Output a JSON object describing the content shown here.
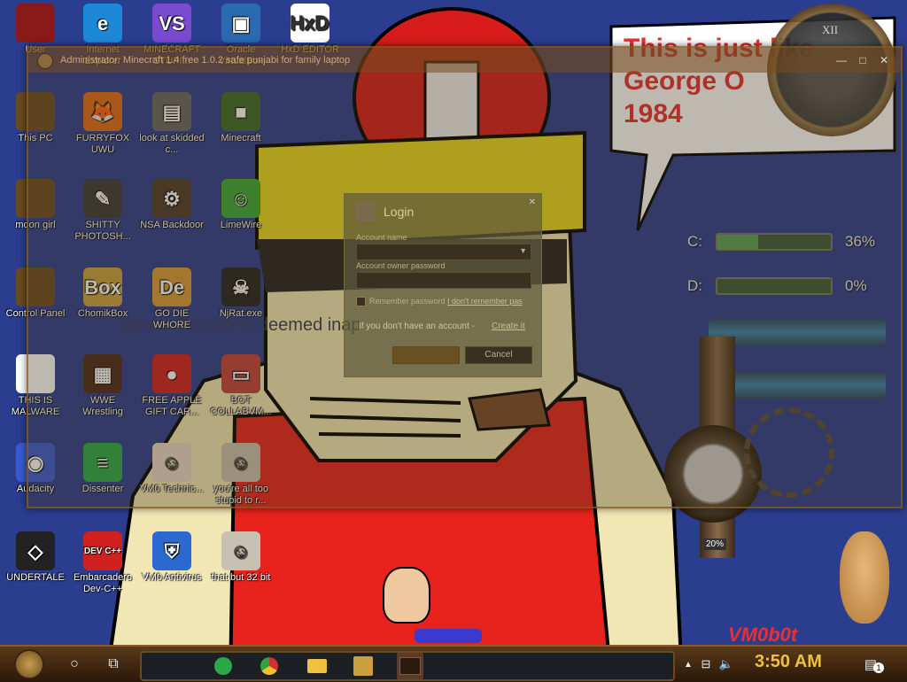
{
  "desktop_icons": [
    {
      "label": "User",
      "color": "#8a1a1a",
      "glyph": "",
      "icon": "user-folder-icon"
    },
    {
      "label": "Internet Explorer",
      "color": "#1e88d8",
      "glyph": "e",
      "icon": "edge-icon"
    },
    {
      "label": "MINECRAFT STUPI...",
      "color": "#7a4ad0",
      "glyph": "VS",
      "icon": "visual-studio-icon"
    },
    {
      "label": "Oracle VirtualBox",
      "color": "#2a6ab0",
      "glyph": "▣",
      "icon": "virtualbox-icon"
    },
    {
      "label": "HxD EDITOR",
      "color": "#ffffff",
      "glyph": "HxD",
      "icon": "hxd-icon"
    },
    {
      "label": "This PC",
      "color": "#6a4a20",
      "glyph": "",
      "icon": "this-pc-icon"
    },
    {
      "label": "FURRYFOX UWU",
      "color": "#e06a1a",
      "glyph": "🦊",
      "icon": "firefox-icon"
    },
    {
      "label": "look at skidded c...",
      "color": "#666666",
      "glyph": "▤",
      "icon": "files-icon"
    },
    {
      "label": "Minecraft",
      "color": "#3a6a2a",
      "glyph": "■",
      "icon": "minecraft-icon"
    },
    {
      "label": "moon girl",
      "color": "#6a4a20",
      "glyph": "",
      "icon": "moon-girl-icon"
    },
    {
      "label": "SHITTY PHOTOSH...",
      "color": "#3a3a3a",
      "glyph": "✎",
      "icon": "gimp-icon"
    },
    {
      "label": "NSA Backdoor",
      "color": "#4a3a2a",
      "glyph": "⚙",
      "icon": "nsa-backdoor-icon"
    },
    {
      "label": "LimeWire",
      "color": "#3aaa3a",
      "glyph": "☺",
      "icon": "limewire-icon"
    },
    {
      "label": "Control Panel",
      "color": "#6a4a20",
      "glyph": "",
      "icon": "control-panel-icon"
    },
    {
      "label": "ChomikBox",
      "color": "#c8a040",
      "glyph": "Box",
      "icon": "chomikbox-icon"
    },
    {
      "label": "GO DIE WHORE",
      "color": "#d89a3a",
      "glyph": "De",
      "icon": "dreamweaver-icon"
    },
    {
      "label": "NjRat.exe",
      "color": "#222222",
      "glyph": "☠",
      "icon": "skull-icon"
    },
    {
      "label": "THIS IS MALWARE",
      "color": "#ffffff",
      "glyph": "",
      "icon": "chrome-icon"
    },
    {
      "label": "WWE Wrestling",
      "color": "#4a2a1a",
      "glyph": "▦",
      "icon": "wwe-icon"
    },
    {
      "label": "FREE APPLE GIFT CAR...",
      "color": "#d02020",
      "glyph": "●",
      "icon": "apple-icon"
    },
    {
      "label": "BOT COLLABVM...",
      "color": "#c04040",
      "glyph": "▭",
      "icon": "bot-icon"
    },
    {
      "label": "Audacity",
      "color": "#3a5ad0",
      "glyph": "◉",
      "icon": "audacity-icon"
    },
    {
      "label": "Dissenter",
      "color": "#2aa84a",
      "glyph": "≡",
      "icon": "dissenter-icon"
    },
    {
      "label": "VM0 Technic...",
      "color": "#e8d8c8",
      "glyph": "☺",
      "icon": "technician-icon"
    },
    {
      "label": "you're all too stupid to r...",
      "color": "#c8c0b0",
      "glyph": "☺",
      "icon": "portrait-icon"
    },
    {
      "label": "UNDERTALE",
      "color": "#222222",
      "glyph": "◇",
      "icon": "unity-icon"
    },
    {
      "label": "Embarcadero Dev-C++",
      "color": "#d02020",
      "glyph": "DEV C++",
      "icon": "devcpp-icon"
    },
    {
      "label": "VM0 Antivirus",
      "color": "#2a6ad0",
      "glyph": "⛨",
      "icon": "shield-icon"
    },
    {
      "label": "that but 32 bit",
      "color": "#c8c0b0",
      "glyph": "☺",
      "icon": "portrait-icon"
    }
  ],
  "window": {
    "title": "Administrator: Minecraft 1.4 free 1.0.2 safe punjabi for family laptop",
    "controls": [
      "—",
      "□",
      "✕"
    ]
  },
  "login_dialog": {
    "title": "Login",
    "account_name_label": "Account name",
    "password_label": "Account owner password",
    "remember_label": "Remember password",
    "forgot_link": "I don't remember pas",
    "no_account_text": "If you don't have an account -",
    "create_link": "Create it",
    "login_button": "",
    "cancel_button": "Cancel"
  },
  "speech_bubble": {
    "line1": "This is just like",
    "line2": "George O",
    "line3": "1984"
  },
  "background_text": "opinion has been deemed inap",
  "disks": [
    {
      "letter": "C:",
      "percent": "36%",
      "fill": 0.36
    },
    {
      "letter": "D:",
      "percent": "0%",
      "fill": 0.0
    }
  ],
  "gauge_label": "20%",
  "watermark": "VM0b0t",
  "taskbar": {
    "clock": "3:50 AM",
    "notification_badge": "1"
  },
  "colors": {
    "taskbar_bg": "#3a2410",
    "clock": "#f0c040",
    "wallpaper_blue": "#2a3d8f"
  }
}
